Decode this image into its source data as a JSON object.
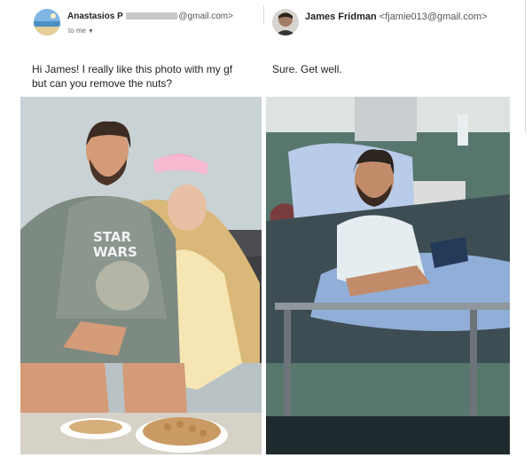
{
  "left_email": {
    "sender_name": "Anastasios P",
    "sender_email_suffix": "@gmail.com>",
    "recipient_label": "to me",
    "message_line1": "Hi James! I really like this photo with my gf",
    "message_line2": "but can you remove the nuts?",
    "photo_shirt_text_line1": "STAR",
    "photo_shirt_text_line2": "WARS"
  },
  "right_email": {
    "sender_name": "James Fridman",
    "sender_email": "<fjamie013@gmail.com>",
    "message": "Sure. Get well."
  },
  "icons": {
    "dropdown": "chevron-down-icon",
    "avatar_left": "beach-avatar-icon",
    "avatar_right": "person-avatar-icon"
  },
  "colors": {
    "text": "#222222",
    "muted": "#666666",
    "divider": "#d8d8d8"
  }
}
